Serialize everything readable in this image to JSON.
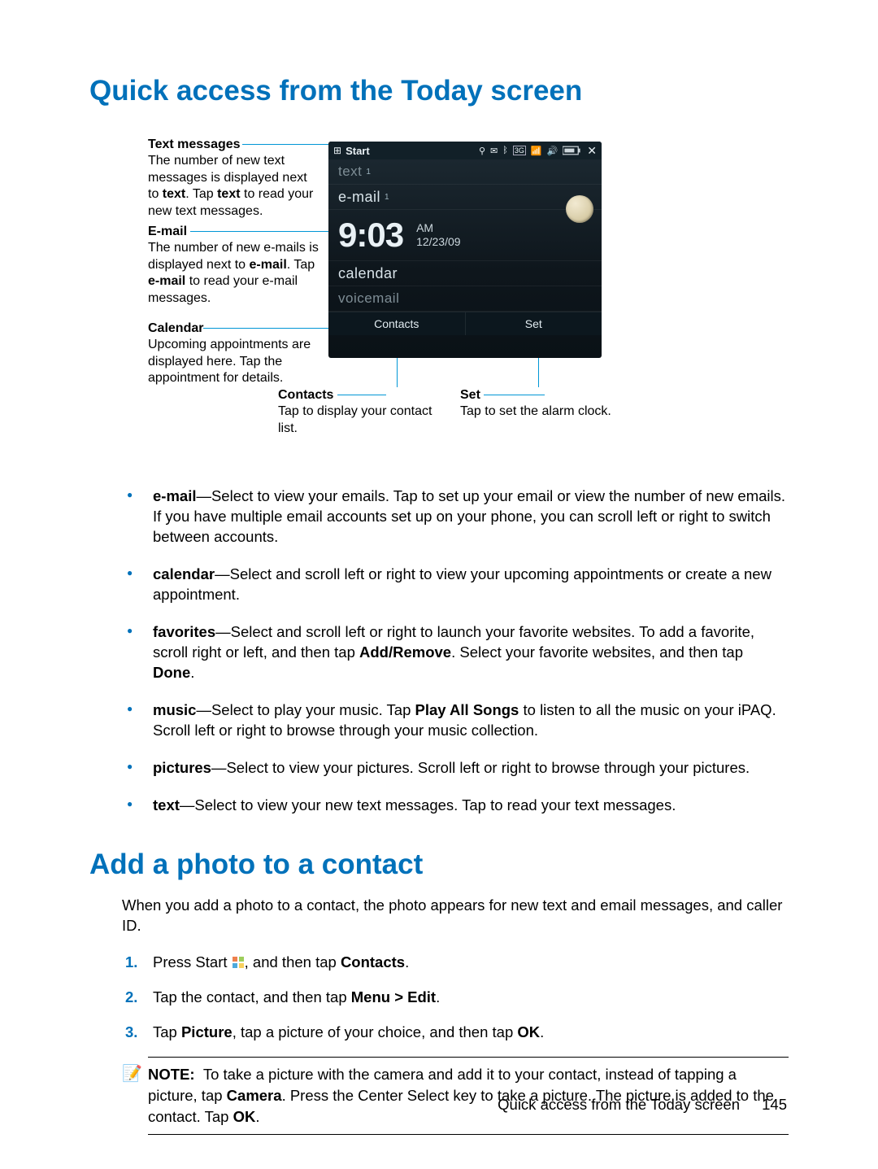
{
  "heading1": "Quick access from the Today screen",
  "heading2": "Add a photo to a contact",
  "figure": {
    "callouts": {
      "text_msgs": {
        "title": "Text messages",
        "body1": "The number of new text messages is displayed next to ",
        "bold1": "text",
        "body2": ". Tap ",
        "bold2": "text",
        "body3": " to read your new text messages."
      },
      "email": {
        "title": "E-mail",
        "body1": "The number of new e-mails is displayed next to ",
        "bold1": "e-mail",
        "body2": ". Tap ",
        "bold2": "e-mail",
        "body3": " to read your e-mail messages."
      },
      "calendar": {
        "title": "Calendar",
        "body": "Upcoming appointments are displayed here. Tap the appointment for details."
      },
      "contacts": {
        "title": "Contacts",
        "body": "Tap to display your contact list."
      },
      "set": {
        "title": "Set",
        "body": "Tap to set the alarm clock."
      }
    },
    "phone": {
      "start": "Start",
      "text_row": "text",
      "text_badge": "1",
      "email_row": "e-mail",
      "email_badge": "1",
      "time": "9:03",
      "ampm": "AM",
      "date": "12/23/09",
      "calendar_row": "calendar",
      "voicemail_row": "voicemail",
      "sk_left": "Contacts",
      "sk_right": "Set"
    }
  },
  "bullets": {
    "email": {
      "lead": "e-mail",
      "text": "—Select to view your emails. Tap to set up your email or view the number of new emails. If you have multiple email accounts set up on your phone, you can scroll left or right to switch between accounts."
    },
    "calendar": {
      "lead": "calendar",
      "text": "—Select and scroll left or right to view your upcoming appointments or create a new appointment."
    },
    "favorites": {
      "lead": "favorites",
      "text1": "—Select and scroll left or right to launch your favorite websites. To add a favorite, scroll right or left, and then tap ",
      "b1": "Add/Remove",
      "text2": ". Select your favorite websites, and then tap ",
      "b2": "Done",
      "text3": "."
    },
    "music": {
      "lead": "music",
      "text1": "—Select to play your music. Tap ",
      "b1": "Play All Songs",
      "text2": " to listen to all the music on your iPAQ. Scroll left or right to browse through your music collection."
    },
    "pictures": {
      "lead": "pictures",
      "text": "—Select to view your pictures. Scroll left or right to browse through your pictures."
    },
    "text": {
      "lead": "text",
      "text": "—Select to view your new text messages. Tap to read your text messages."
    }
  },
  "photo_intro": "When you add a photo to a contact, the photo appears for new text and email messages, and caller ID.",
  "steps": {
    "s1a": "Press Start ",
    "s1b": ", and then tap ",
    "s1c": "Contacts",
    "s1d": ".",
    "s2a": "Tap the contact, and then tap ",
    "s2b": "Menu > Edit",
    "s2c": ".",
    "s3a": "Tap ",
    "s3b": "Picture",
    "s3c": ", tap a picture of your choice, and then tap ",
    "s3d": "OK",
    "s3e": "."
  },
  "note": {
    "label": "NOTE:",
    "t1": "To take a picture with the camera and add it to your contact, instead of tapping a picture, tap ",
    "b1": "Camera",
    "t2": ". Press the Center Select key to take a picture. The picture is added to the contact. Tap ",
    "b2": "OK",
    "t3": "."
  },
  "footer": {
    "text": "Quick access from the Today screen",
    "page": "145"
  }
}
